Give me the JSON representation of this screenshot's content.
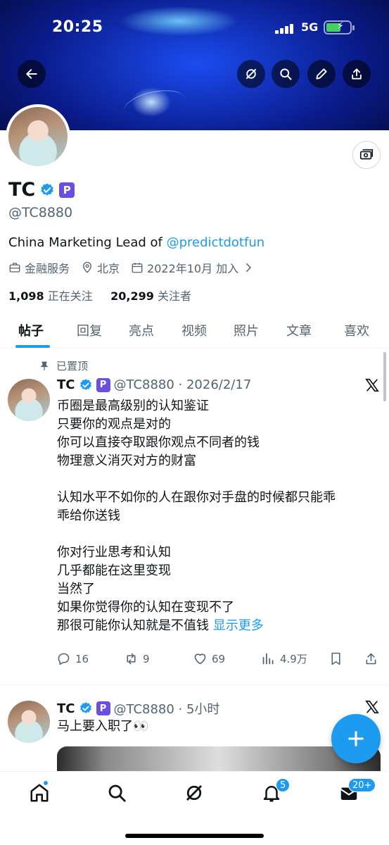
{
  "status_bar": {
    "time": "20:25",
    "network": "5G"
  },
  "profile": {
    "name": "TC",
    "badge_letter": "P",
    "handle": "@TC8880",
    "bio_prefix": "China Marketing Lead of ",
    "bio_link": "@predictdotfun",
    "category": "金融服务",
    "location": "北京",
    "joined": "2022年10月 加入",
    "following_count": "1,098",
    "following_label": "正在关注",
    "followers_count": "20,299",
    "followers_label": "关注者"
  },
  "tabs": [
    "帖子",
    "回复",
    "亮点",
    "视频",
    "照片",
    "文章",
    "喜欢"
  ],
  "pinned_label": "已置顶",
  "tweets": [
    {
      "name": "TC",
      "handle_time": "@TC8880 · 2026/2/17",
      "lines": [
        "币圈是最高级别的认知鉴证",
        "只要你的观点是对的",
        "你可以直接夺取跟你观点不同者的钱",
        "物理意义消灭对方的财富",
        "",
        "认知水平不如你的人在跟你对手盘的时候都只能乖",
        "乖给你送钱",
        "",
        "你对行业思考和认知",
        "几乎都能在这里变现",
        "当然了",
        "如果你觉得你的认知在变现不了",
        "那很可能你认知就是不值钱"
      ],
      "show_more": "显示更多",
      "replies": "16",
      "retweets": "9",
      "likes": "69",
      "views": "4.9万"
    },
    {
      "name": "TC",
      "handle_time": "@TC8880 · 5小时",
      "text": "马上要入职了👀"
    }
  ],
  "bottom_nav": {
    "notifications_badge": "5",
    "messages_badge": "20+"
  },
  "colors": {
    "accent": "#1d9bf0",
    "premium_badge": "#6b4fe0",
    "text_secondary": "#536471"
  }
}
